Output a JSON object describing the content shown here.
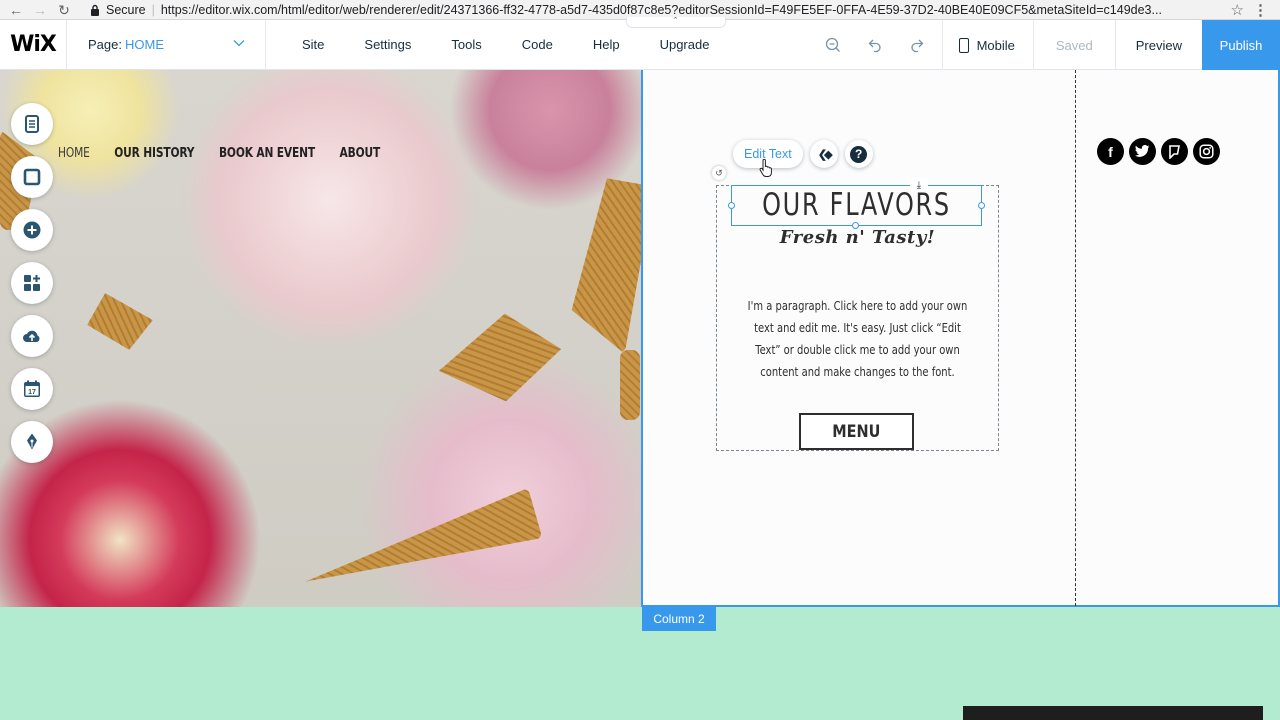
{
  "browser": {
    "secure_label": "Secure",
    "url": "https://editor.wix.com/html/editor/web/renderer/edit/24371366-ff32-4778-a5d7-435d0f87c8e5?editorSessionId=F49FE5EF-0FFA-4E59-37D2-40BE40E09CF5&metaSiteId=c149de3..."
  },
  "editor_bar": {
    "logo": "WiX",
    "page_label": "Page:",
    "page_value": "HOME",
    "menu": [
      "Site",
      "Settings",
      "Tools",
      "Code",
      "Help",
      "Upgrade"
    ],
    "mobile_label": "Mobile",
    "saved_label": "Saved",
    "preview_label": "Preview",
    "publish_label": "Publish"
  },
  "site_nav": [
    "HOME",
    "OUR HISTORY",
    "BOOK AN EVENT",
    "ABOUT"
  ],
  "tool_rail": [
    "pages-icon",
    "background-icon",
    "add-icon",
    "app-market-icon",
    "upload-icon",
    "events-icon",
    "blog-icon"
  ],
  "edit_toolbar": {
    "edit_text_label": "Edit Text",
    "help_glyph": "?"
  },
  "content": {
    "title": "OUR FLAVORS",
    "subtitle": "Fresh n' Tasty!",
    "paragraph": "I'm a paragraph. Click here to add your own text and edit me. It's easy. Just click “Edit Text” or double click me to add your own content and make changes to the font.",
    "button_label": "MENU"
  },
  "social": [
    "facebook-icon",
    "twitter-icon",
    "foursquare-icon",
    "instagram-icon"
  ],
  "column_tag": "Column 2",
  "colors": {
    "accent": "#3899ec",
    "strip": "#b2ebd0",
    "text_dark": "#2e2e2e"
  }
}
